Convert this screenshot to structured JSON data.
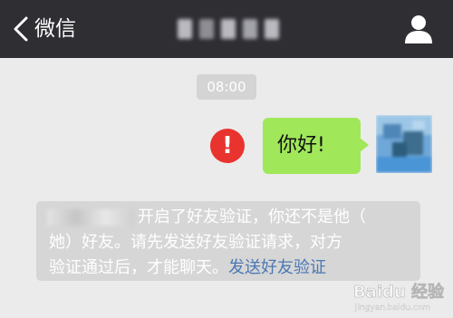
{
  "topbar": {
    "back_label": "微信",
    "back_icon": "chevron-left-icon",
    "title": "",
    "profile_icon": "person-icon",
    "background": "#2e2e33"
  },
  "chat": {
    "timestamp": "08:00",
    "message": {
      "text": "你好!",
      "status_icon": "exclamation-icon",
      "bubble_color": "#a0e75a",
      "status_color": "#e8332e"
    },
    "system_notice": {
      "line1_suffix": "开启了好友验证，你还不是他（",
      "line2": "她）好友。请先发送好友验证请求，对方",
      "line3_text": "验证通过后，才能聊天。",
      "link_text": "发送好友验证",
      "link_color": "#4b78b4"
    }
  },
  "watermark": {
    "text": "Baidu 经验",
    "sub": "jingyan.baidu.com"
  }
}
